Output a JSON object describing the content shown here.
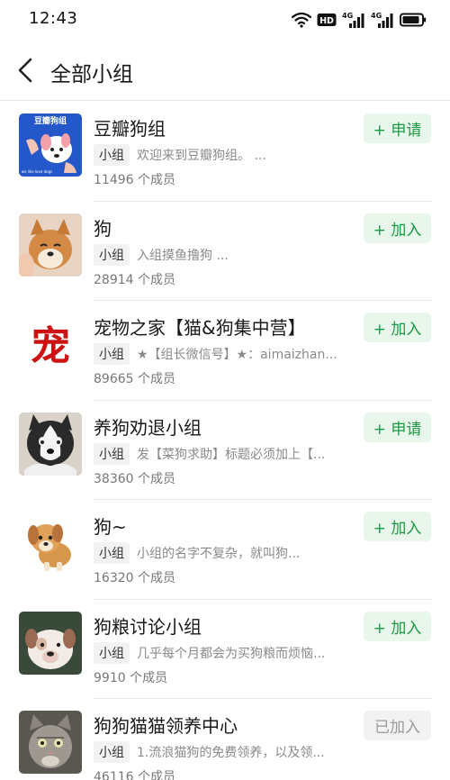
{
  "status_bar": {
    "time": "12:43",
    "hd_badge": "HD",
    "network_1": "4G",
    "network_2": "4G",
    "icons": [
      "wifi-icon",
      "hd-icon",
      "signal-icon",
      "signal-icon",
      "battery-icon"
    ]
  },
  "nav": {
    "back_icon": "chevron-left-icon",
    "title": "全部小组"
  },
  "colors": {
    "accent_green": "#1c9b44",
    "button_green_bg": "#e8f6ec",
    "joined_gray_bg": "#f2f2f2",
    "joined_gray_text": "#9a9a9a"
  },
  "groups": [
    {
      "name": "豆瓣狗组",
      "tag": "小组",
      "desc": "欢迎来到豆瓣狗组。 ...",
      "members": "11496 个成员",
      "action": "+ 申请",
      "joined": false,
      "avatar_text": "豆瓣狗组",
      "avatar_caption": "we like love dogs"
    },
    {
      "name": "狗",
      "tag": "小组",
      "desc": "入组摸鱼撸狗 ...",
      "members": "28914 个成员",
      "action": "+ 加入",
      "joined": false
    },
    {
      "name": "宠物之家【猫&狗集中营】",
      "tag": "小组",
      "desc": "★【组长微信号】★：aimaizhan...",
      "members": "89665 个成员",
      "action": "+ 加入",
      "joined": false,
      "avatar_text": "宠"
    },
    {
      "name": "养狗劝退小组",
      "tag": "小组",
      "desc": "发【菜狗求助】标题必须加上【...",
      "members": "38360 个成员",
      "action": "+ 申请",
      "joined": false
    },
    {
      "name": "狗~",
      "tag": "小组",
      "desc": "小组的名字不复杂，就叫狗...",
      "members": "16320 个成员",
      "action": "+ 加入",
      "joined": false
    },
    {
      "name": "狗粮讨论小组",
      "tag": "小组",
      "desc": "几乎每个月都会为买狗粮而烦恼...",
      "members": "9910 个成员",
      "action": "+ 加入",
      "joined": false
    },
    {
      "name": "狗狗猫猫领养中心",
      "tag": "小组",
      "desc": "1.流浪猫狗的免费领养，以及领...",
      "members": "46116 个成员",
      "action": "已加入",
      "joined": true
    }
  ]
}
